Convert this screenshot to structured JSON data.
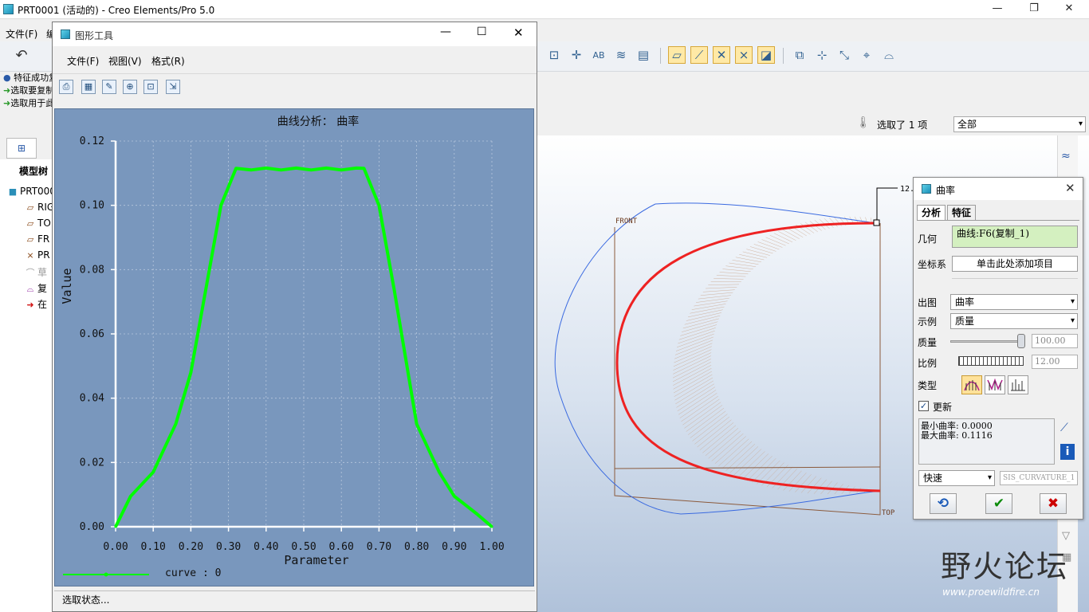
{
  "window": {
    "title": "PRT0001 (活动的) - Creo Elements/Pro 5.0",
    "minimize": "—",
    "maximize": "❐",
    "close": "✕"
  },
  "menu": {
    "file": "文件(F)",
    "partial": "编"
  },
  "messages": [
    "特征成功复",
    "选取要复制",
    "选取用于此"
  ],
  "selection": {
    "label": "选取了 1 项",
    "filter": "全部"
  },
  "model_tree": {
    "title": "模型树",
    "items": [
      {
        "label": "PRT000",
        "icon": "part-icon"
      },
      {
        "label": "RIG",
        "icon": "plane-icon"
      },
      {
        "label": "TO",
        "icon": "plane-icon"
      },
      {
        "label": "FR",
        "icon": "plane-icon"
      },
      {
        "label": "PR",
        "icon": "csys-icon"
      },
      {
        "label": "草",
        "icon": "sketch-icon"
      },
      {
        "label": "复",
        "icon": "copy-icon"
      },
      {
        "label": "在",
        "icon": "insert-arrow-icon"
      }
    ]
  },
  "graph_tool": {
    "title": "图形工具",
    "menus": [
      "文件(F)",
      "视图(V)",
      "格式(R)"
    ],
    "status": "选取状态..."
  },
  "chart_data": {
    "type": "line",
    "title": "曲线分析： 曲率",
    "xlabel": "Parameter",
    "ylabel": "Value",
    "xlim": [
      0,
      1
    ],
    "ylim": [
      0,
      0.12
    ],
    "x_ticks": [
      "0.00",
      "0.10",
      "0.20",
      "0.30",
      "0.40",
      "0.50",
      "0.60",
      "0.70",
      "0.80",
      "0.90",
      "1.00"
    ],
    "y_ticks": [
      "0.00",
      "0.02",
      "0.04",
      "0.06",
      "0.08",
      "0.10",
      "0.12"
    ],
    "grid": true,
    "legend": "bottom-left",
    "series": [
      {
        "name": "curve : 0",
        "color": "#00ff00",
        "x": [
          0,
          0.04,
          0.1,
          0.16,
          0.2,
          0.24,
          0.28,
          0.32,
          0.36,
          0.4,
          0.44,
          0.48,
          0.52,
          0.56,
          0.6,
          0.64,
          0.66,
          0.7,
          0.74,
          0.8,
          0.86,
          0.9,
          0.96,
          1.0
        ],
        "y": [
          0,
          0.0095,
          0.017,
          0.032,
          0.048,
          0.074,
          0.1,
          0.1115,
          0.111,
          0.1116,
          0.111,
          0.1116,
          0.111,
          0.1116,
          0.111,
          0.1116,
          0.1115,
          0.1,
          0.074,
          0.032,
          0.017,
          0.0095,
          0.004,
          0
        ]
      }
    ]
  },
  "viewport": {
    "front_label": "FRONT",
    "top_label": "TOP",
    "dim_label": "12."
  },
  "curvature_dialog": {
    "title": "曲率",
    "tabs": [
      "分析",
      "特征"
    ],
    "geometry_label": "几何",
    "geometry_value": "曲线:F6(复制_1)",
    "csys_label": "坐标系",
    "csys_value": "单击此处添加项目",
    "plot_label": "出图",
    "plot_value": "曲率",
    "display_label": "示例",
    "display_value": "质量",
    "quality_label": "质量",
    "quality_value": "100.00",
    "quality_slider": 1.0,
    "scale_label": "比例",
    "scale_value": "12.00",
    "type_label": "类型",
    "update_label": "更新",
    "update_checked": true,
    "result_min": "最小曲率: 0.0000",
    "result_max": "最大曲率: 0.1116",
    "mode_value": "快速",
    "feature_name": "SIS_CURVATURE_1",
    "ok_icon": "check-icon",
    "cancel_icon": "cross-icon",
    "repeat_icon": "repeat-icon"
  },
  "watermark": {
    "big": "野火论坛",
    "small": "www.proewildfire.cn"
  }
}
